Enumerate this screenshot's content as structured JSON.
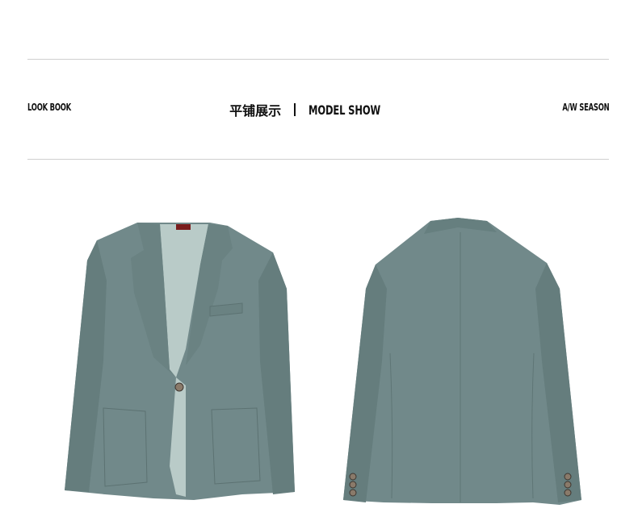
{
  "header": {
    "left_tag": "LOOK BOOK",
    "center_cn": "平铺展示",
    "center_en": "MODEL SHOW",
    "right_tag": "A/W SEASON"
  },
  "images": [
    {
      "name": "jacket-front",
      "color": "#6f8787"
    },
    {
      "name": "jacket-back",
      "color": "#6f8787"
    }
  ],
  "colors": {
    "fabric": "#71898a",
    "fabric_dark": "#5e7474",
    "lining": "#b7c9c6",
    "rule": "#cfcfcf"
  }
}
